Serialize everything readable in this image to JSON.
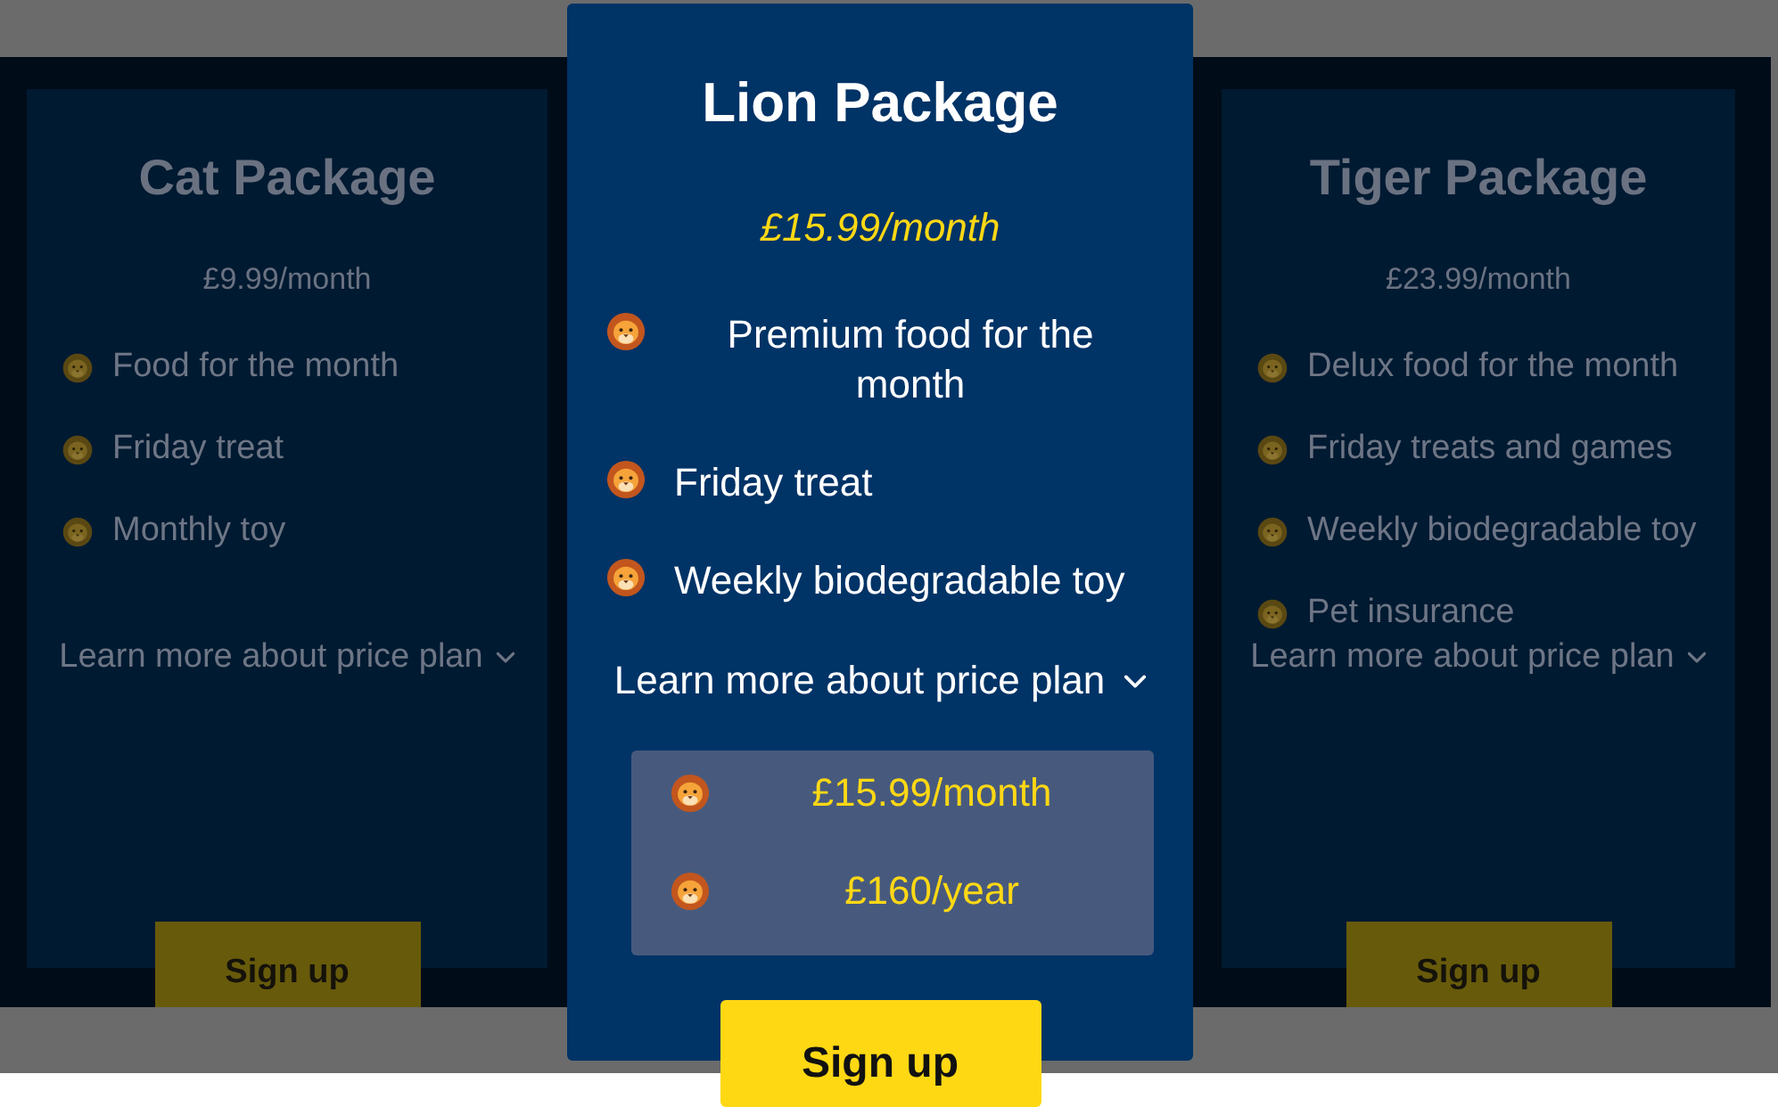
{
  "packages": [
    {
      "title": "Cat Package",
      "price": "£9.99/month",
      "selected": false,
      "features": [
        "Food for the month",
        "Friday treat",
        "Monthly toy"
      ],
      "learn_more": "Learn more about price plan",
      "button": "Sign up"
    },
    {
      "title": "Lion Package",
      "price": "£15.99/month",
      "selected": true,
      "features": [
        "Premium food for the month",
        "Friday treat",
        "Weekly biodegradable toy"
      ],
      "learn_more": "Learn more about price plan",
      "price_options": [
        "£15.99/month",
        "£160/year"
      ],
      "button": "Sign up"
    },
    {
      "title": "Tiger Package",
      "price": "£23.99/month",
      "selected": false,
      "features": [
        "Delux food for the month",
        "Friday treats and games",
        "Weekly biodegradable toy",
        "Pet insurance"
      ],
      "learn_more": "Learn more about price plan",
      "button": "Sign up"
    }
  ]
}
